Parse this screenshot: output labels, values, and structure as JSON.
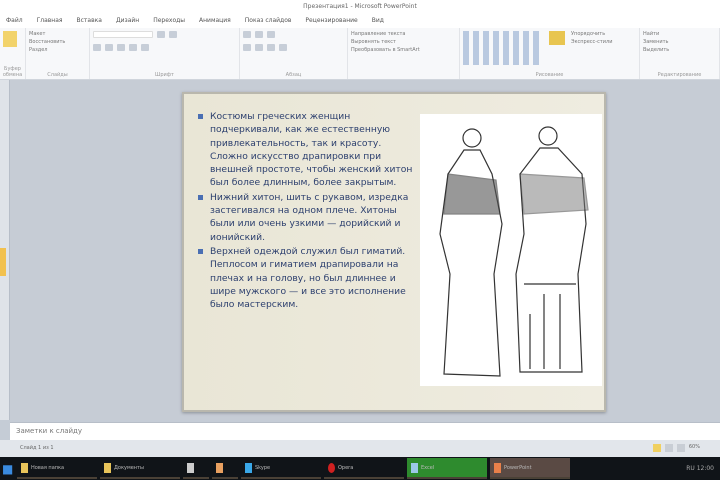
{
  "window": {
    "title": "Презентация1 - Microsoft PowerPoint"
  },
  "tabs": [
    "Файл",
    "Главная",
    "Вставка",
    "Дизайн",
    "Переходы",
    "Анимация",
    "Показ слайдов",
    "Рецензирование",
    "Вид"
  ],
  "ribbon": {
    "groups": [
      "Буфер обмена",
      "Слайды",
      "Шрифт",
      "Абзац",
      "Рисование",
      "Редактирование"
    ],
    "slides_buttons": [
      "Макет",
      "Восстановить",
      "Раздел"
    ],
    "paragraph_buttons": [
      "Направление текста",
      "Выровнять текст",
      "Преобразовать в SmartArt"
    ],
    "drawing_buttons": [
      "Упорядочить",
      "Экспресс-стили"
    ],
    "editing_buttons": [
      "Найти",
      "Заменить",
      "Выделить"
    ]
  },
  "slide": {
    "bullets": [
      "Костюмы греческих женщин подчеркивали, как же естественную привлекательность, так и красоту. Сложно искусство драпировки при внешней простоте, чтобы женский хитон был более длинным, более закрытым.",
      "Нижний хитон, шить с рукавом, изредка застегивался на одном плече. Хитоны были или очень узкими — дорийский и ионийский.",
      "Верхней одеждой служил был гиматий. Пеплосом и гиматием драпировали на плечах и на голову, но был длиннее и шире мужского — и все это исполнение было мастерским."
    ],
    "image_alt": "greek-women-costume-illustration"
  },
  "notes": {
    "placeholder": "Заметки к слайду"
  },
  "status": {
    "left": "Слайд 1 из 1",
    "zoom": "60%"
  },
  "taskbar": {
    "items": [
      "Новая папка",
      "Документы",
      "Explorer",
      "Skype",
      "Word",
      "Opera",
      "Excel",
      "PowerPoint"
    ],
    "tray": "RU 12:00"
  },
  "colors": {
    "accent": "#2e8b2e",
    "text": "#2c3f6e",
    "bullet": "#4a6fb3"
  }
}
